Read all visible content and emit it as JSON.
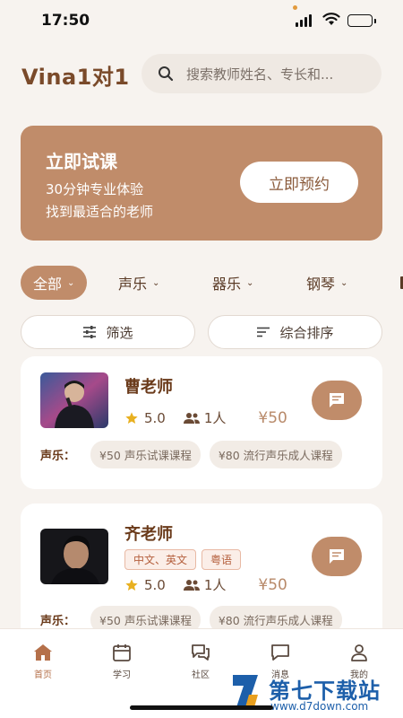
{
  "status_bar": {
    "time": "17:50"
  },
  "header": {
    "title": "Vina1对1",
    "search_placeholder": "搜索教师姓名、专长和..."
  },
  "banner": {
    "title": "立即试课",
    "line1": "30分钟专业体验",
    "line2": "找到最适合的老师",
    "button": "立即预约"
  },
  "categories": [
    "全部",
    "声乐",
    "器乐",
    "钢琴"
  ],
  "filters": {
    "filter_label": "筛选",
    "sort_label": "综合排序"
  },
  "teachers": [
    {
      "name": "曹老师",
      "rating": "5.0",
      "students": "1人",
      "price": "¥50",
      "course_label": "声乐：",
      "courses": [
        "¥50 声乐试课课程",
        "¥80 流行声乐成人课程"
      ]
    },
    {
      "name": "齐老师",
      "languages": [
        "中文、英文",
        "粤语"
      ],
      "rating": "5.0",
      "students": "1人",
      "price": "¥50",
      "course_label": "声乐：",
      "courses": [
        "¥50 声乐试课课程",
        "¥80 流行声乐成人课程"
      ]
    }
  ],
  "tabbar": [
    {
      "label": "首页",
      "icon": "home-icon",
      "active": true
    },
    {
      "label": "学习",
      "icon": "calendar-icon"
    },
    {
      "label": "社区",
      "icon": "community-icon"
    },
    {
      "label": "消息",
      "icon": "message-icon"
    },
    {
      "label": "我的",
      "icon": "profile-icon"
    }
  ],
  "watermark": {
    "title": "第七下载站",
    "url": "www.d7down.com"
  },
  "colors": {
    "accent": "#c08c6a",
    "background": "#f7f3ef",
    "title": "#7a4a2a",
    "star": "#e8b020"
  }
}
